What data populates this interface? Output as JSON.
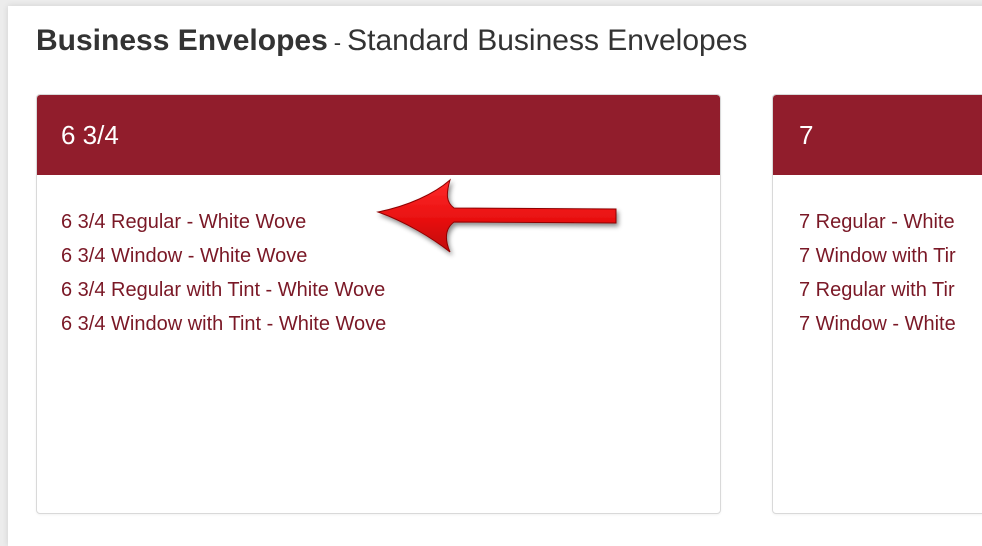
{
  "heading": {
    "title": "Business Envelopes",
    "separator": "-",
    "subtitle": "Standard Business Envelopes"
  },
  "panels": [
    {
      "title": "6 3/4",
      "links": [
        "6 3/4 Regular - White Wove",
        "6 3/4 Window - White Wove",
        "6 3/4 Regular with Tint - White Wove",
        "6 3/4 Window with Tint - White Wove"
      ]
    },
    {
      "title": "7",
      "links": [
        "7 Regular - White",
        "7 Window with Tir",
        "7 Regular with Tir",
        "7 Window - White"
      ]
    }
  ],
  "colors": {
    "panel_header": "#911d2c",
    "link": "#7a1826",
    "annotation_arrow": "#e81010"
  },
  "annotation": {
    "icon": "red-arrow-icon"
  }
}
